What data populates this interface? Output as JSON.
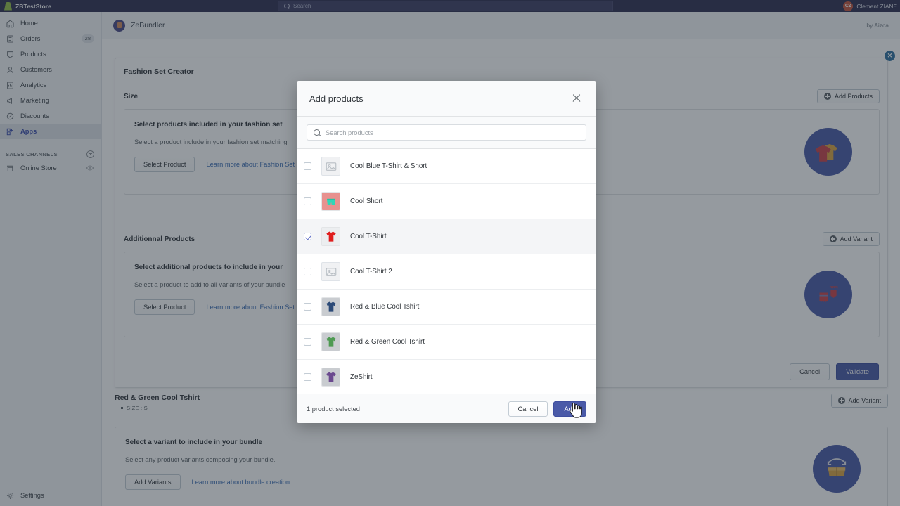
{
  "topbar": {
    "store_name": "ZBTestStore",
    "search_placeholder": "Search",
    "user_initials": "CZ",
    "user_name": "Clement ZIANE"
  },
  "sidebar": {
    "items": [
      {
        "label": "Home",
        "icon": "home-icon",
        "badge": ""
      },
      {
        "label": "Orders",
        "icon": "orders-icon",
        "badge": "28"
      },
      {
        "label": "Products",
        "icon": "products-icon",
        "badge": ""
      },
      {
        "label": "Customers",
        "icon": "customers-icon",
        "badge": ""
      },
      {
        "label": "Analytics",
        "icon": "analytics-icon",
        "badge": ""
      },
      {
        "label": "Marketing",
        "icon": "marketing-icon",
        "badge": ""
      },
      {
        "label": "Discounts",
        "icon": "discounts-icon",
        "badge": ""
      },
      {
        "label": "Apps",
        "icon": "apps-icon",
        "badge": ""
      }
    ],
    "section_label": "SALES CHANNELS",
    "channels": [
      {
        "label": "Online Store",
        "icon": "store-icon"
      }
    ],
    "settings_label": "Settings"
  },
  "app_header": {
    "app_name": "ZeBundler",
    "by_label": "by Aizca"
  },
  "page": {
    "title": "Fashion Set Creator",
    "sections": [
      {
        "name": "Size",
        "action_label": "Add Products",
        "panel_title": "Select products included in your fashion set",
        "panel_sub": "Select a product include in your fashion set matching",
        "button_label": "Select Product",
        "link_label": "Learn more about Fashion Set"
      },
      {
        "name": "Additionnal Products",
        "action_label": "Add Variant",
        "panel_title": "Select additional products to include in your",
        "panel_sub": "Select a product to add to all variants of your bundle",
        "button_label": "Select Product",
        "link_label": "Learn more about Fashion Set"
      }
    ],
    "footer": {
      "cancel_label": "Cancel",
      "validate_label": "Validate"
    },
    "variant_block": {
      "title": "Red & Green Cool Tshirt",
      "meta": "SIZE : S",
      "action_label": "Add Variant",
      "panel_title": "Select a variant to include in your bundle",
      "panel_sub": "Select any product variants composing your bundle.",
      "button_label": "Add Variants",
      "link_label": "Learn more about bundle creation"
    }
  },
  "modal": {
    "title": "Add products",
    "close_icon": "close-icon",
    "search_placeholder": "Search products",
    "search_value": "",
    "products": [
      {
        "name": "Cool Blue T-Shirt & Short",
        "checked": false,
        "thumb": "placeholder"
      },
      {
        "name": "Cool Short",
        "checked": false,
        "thumb": "short-teal"
      },
      {
        "name": "Cool T-Shirt",
        "checked": true,
        "thumb": "tshirt-red"
      },
      {
        "name": "Cool T-Shirt 2",
        "checked": false,
        "thumb": "placeholder"
      },
      {
        "name": "Red & Blue Cool Tshirt",
        "checked": false,
        "thumb": "tshirt-blue"
      },
      {
        "name": "Red & Green Cool Tshirt",
        "checked": false,
        "thumb": "tshirt-green"
      },
      {
        "name": "ZeShirt",
        "checked": false,
        "thumb": "tshirt-purple"
      }
    ],
    "selected_count_label": "1 product selected",
    "cancel_label": "Cancel",
    "add_label": "Add"
  },
  "colors": {
    "topbar_bg": "#2f2f52",
    "primary": "#4a5aa8",
    "checkbox_accent": "#5c6ac4",
    "link": "#3e6fb5",
    "illustration_circle": "#4a5aa8",
    "illustration_shirt": "#c8424a"
  }
}
